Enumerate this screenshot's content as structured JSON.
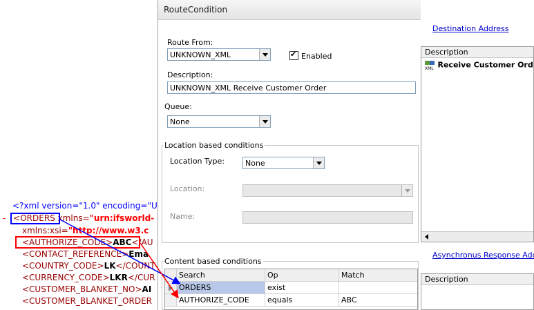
{
  "window": {
    "title": "RouteCondition",
    "route_from_label": "Route From:",
    "route_from_value": "UNKNOWN_XML",
    "enabled_label": "Enabled",
    "description_label": "Description:",
    "description_value": "UNKNOWN_XML Receive Customer Order",
    "queue_label": "Queue:",
    "queue_value": "None",
    "location_group_title": "Location based conditions",
    "location_type_label": "Location Type:",
    "location_type_value": "None",
    "location_label": "Location:",
    "name_label": "Name:",
    "content_group_title": "Content based conditions",
    "grid": {
      "columns": [
        "Search",
        "Op",
        "Match"
      ],
      "rows": [
        [
          "ORDERS",
          "exist",
          ""
        ],
        [
          "AUTHORIZE_CODE",
          "equals",
          "ABC"
        ]
      ]
    }
  },
  "right_pane": {
    "destination_link": "Destination Address",
    "desc_header": "Description",
    "item_label": "Receive Customer Order",
    "async_link": "Asynchronus Response Addres",
    "desc_header_2": "Description"
  },
  "xml": {
    "decl": "<?xml version=\"1.0\" encoding=\"U",
    "minus": "-",
    "orders_tag": "<ORDERS",
    "xmlns_attr": "xmlns=",
    "xmlns_value": "\"urn:ifsworld-",
    "xsi_attr": "xmlns:xsi=",
    "xsi_value": "\"http://www.w3.c",
    "auth_open": "<AUTHORIZE_CODE>",
    "auth_value": "ABC",
    "auth_close": "</AU",
    "contact_open": "<CONTACT_REFERENCE>",
    "contact_value": "Ema",
    "country_open": "<COUNTRY_CODE>",
    "country_value": "LK",
    "country_close": "</COUNT",
    "currency_open": "<CURRENCY_CODE>",
    "currency_value": "LKR",
    "currency_close": "</CUR",
    "blanket_open": "<CUSTOMER_BLANKET_NO>",
    "blanket_value": "AI",
    "blanket_order_open": "<CUSTOMER_BLANKET_ORDER"
  },
  "colors": {
    "accent_blue": "#0000ff",
    "accent_red": "#ff0000",
    "xml_tag": "#990000",
    "link": "#0000cc"
  }
}
